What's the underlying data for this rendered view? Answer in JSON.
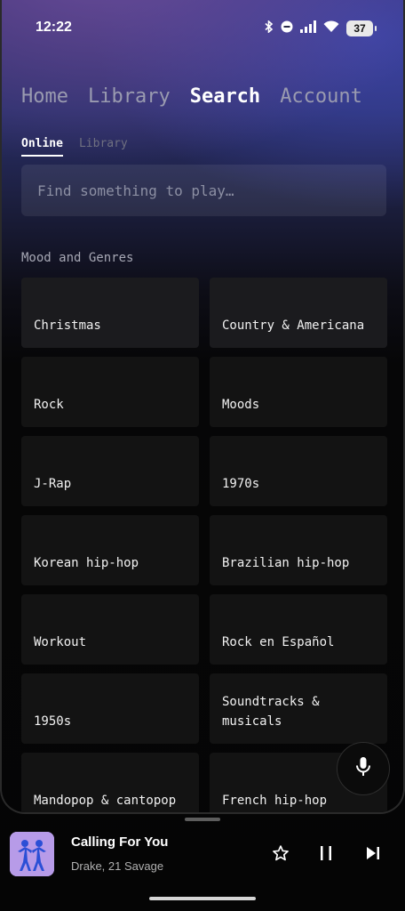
{
  "status_bar": {
    "time": "12:22",
    "battery": "37",
    "icons": [
      "bluetooth-icon",
      "do-not-disturb-icon",
      "signal-icon",
      "wifi-icon",
      "battery-icon"
    ]
  },
  "nav": {
    "items": [
      {
        "label": "Home",
        "active": false
      },
      {
        "label": "Library",
        "active": false
      },
      {
        "label": "Search",
        "active": true
      },
      {
        "label": "Account",
        "active": false
      }
    ]
  },
  "subtabs": [
    {
      "label": "Online",
      "active": true
    },
    {
      "label": "Library",
      "active": false
    }
  ],
  "search": {
    "placeholder": "Find something to play…"
  },
  "section_title": "Mood and Genres",
  "genres": [
    "Christmas",
    "Country & Americana",
    "Rock",
    "Moods",
    "J-Rap",
    "1970s",
    "Korean hip-hop",
    "Brazilian hip-hop",
    "Workout",
    "Rock en Español",
    "1950s",
    "Soundtracks & musicals",
    "Mandopop & cantopop",
    "French hip-hop"
  ],
  "player": {
    "title": "Calling For You",
    "artist": "Drake, 21 Savage",
    "art_color": "#b79be8"
  },
  "colors": {
    "accent_purple": "#3b2f6e",
    "tile_bg": "#131313"
  }
}
